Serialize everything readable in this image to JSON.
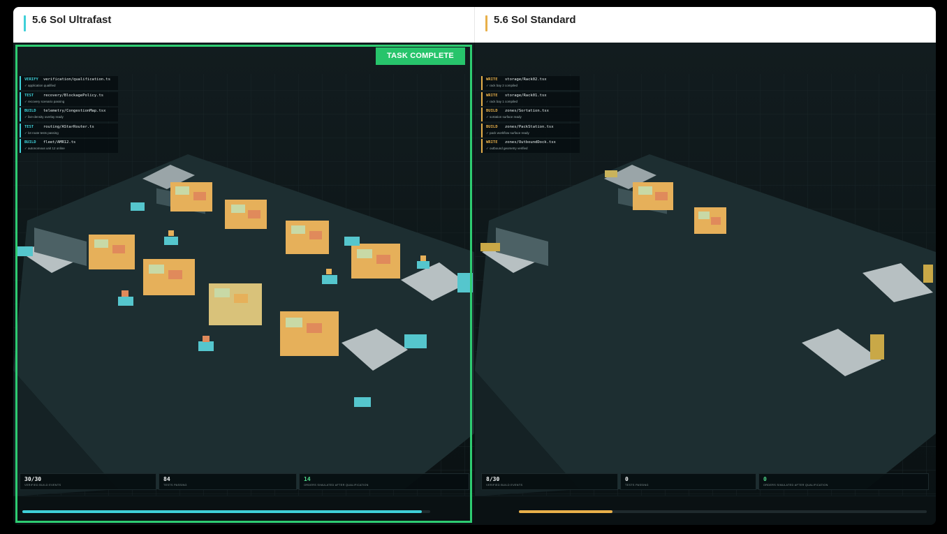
{
  "panels": [
    {
      "title": "5.6 Sol Ultrafast",
      "accent_color": "#3fd0d8",
      "status_badge": "TASK COMPLETE",
      "log": [
        {
          "kind": "VERIFY",
          "file": "verification/qualification.ts",
          "note": "✓ application qualified"
        },
        {
          "kind": "TEST",
          "file": "recovery/BlockagePolicy.ts",
          "note": "✓ recovery scenario passing"
        },
        {
          "kind": "BUILD",
          "file": "telemetry/CongestionMap.tsx",
          "note": "✓ live-density overlay ready"
        },
        {
          "kind": "TEST",
          "file": "routing/AStarRouter.ts",
          "note": "✓ lot route tests passing"
        },
        {
          "kind": "BUILD",
          "file": "fleet/AMR12.ts",
          "note": "✓ autonomous unit 12 online"
        }
      ],
      "stats": [
        {
          "value": "30/30",
          "label": "VERIFIED BUILD EVENTS"
        },
        {
          "value": "84",
          "label": "TESTS PASSING"
        },
        {
          "value": "14",
          "label": "ORDERS SIMULATED AFTER QUALIFICATION"
        }
      ],
      "progress": 0.98,
      "progress_color": "#3fd0d8"
    },
    {
      "title": "5.6 Sol Standard",
      "accent_color": "#e8b04a",
      "log": [
        {
          "kind": "WRITE",
          "file": "storage/Rack02.tsx",
          "note": "✓ rack bay 2 compiled"
        },
        {
          "kind": "WRITE",
          "file": "storage/Rack01.tsx",
          "note": "✓ rack bay 1 compiled"
        },
        {
          "kind": "BUILD",
          "file": "zones/Sortation.tsx",
          "note": "✓ sortation surface ready"
        },
        {
          "kind": "BUILD",
          "file": "zones/PackStation.tsx",
          "note": "✓ pack workflow surface ready"
        },
        {
          "kind": "WRITE",
          "file": "zones/OutboundDock.tsx",
          "note": "✓ outbound geometry verified"
        }
      ],
      "stats": [
        {
          "value": "8/30",
          "label": "VERIFIED BUILD EVENTS"
        },
        {
          "value": "0",
          "label": "TESTS PASSING"
        },
        {
          "value": "0",
          "label": "ORDERS SIMULATED AFTER QUALIFICATION"
        }
      ],
      "progress": 0.23,
      "progress_color": "#e8b04a"
    }
  ]
}
